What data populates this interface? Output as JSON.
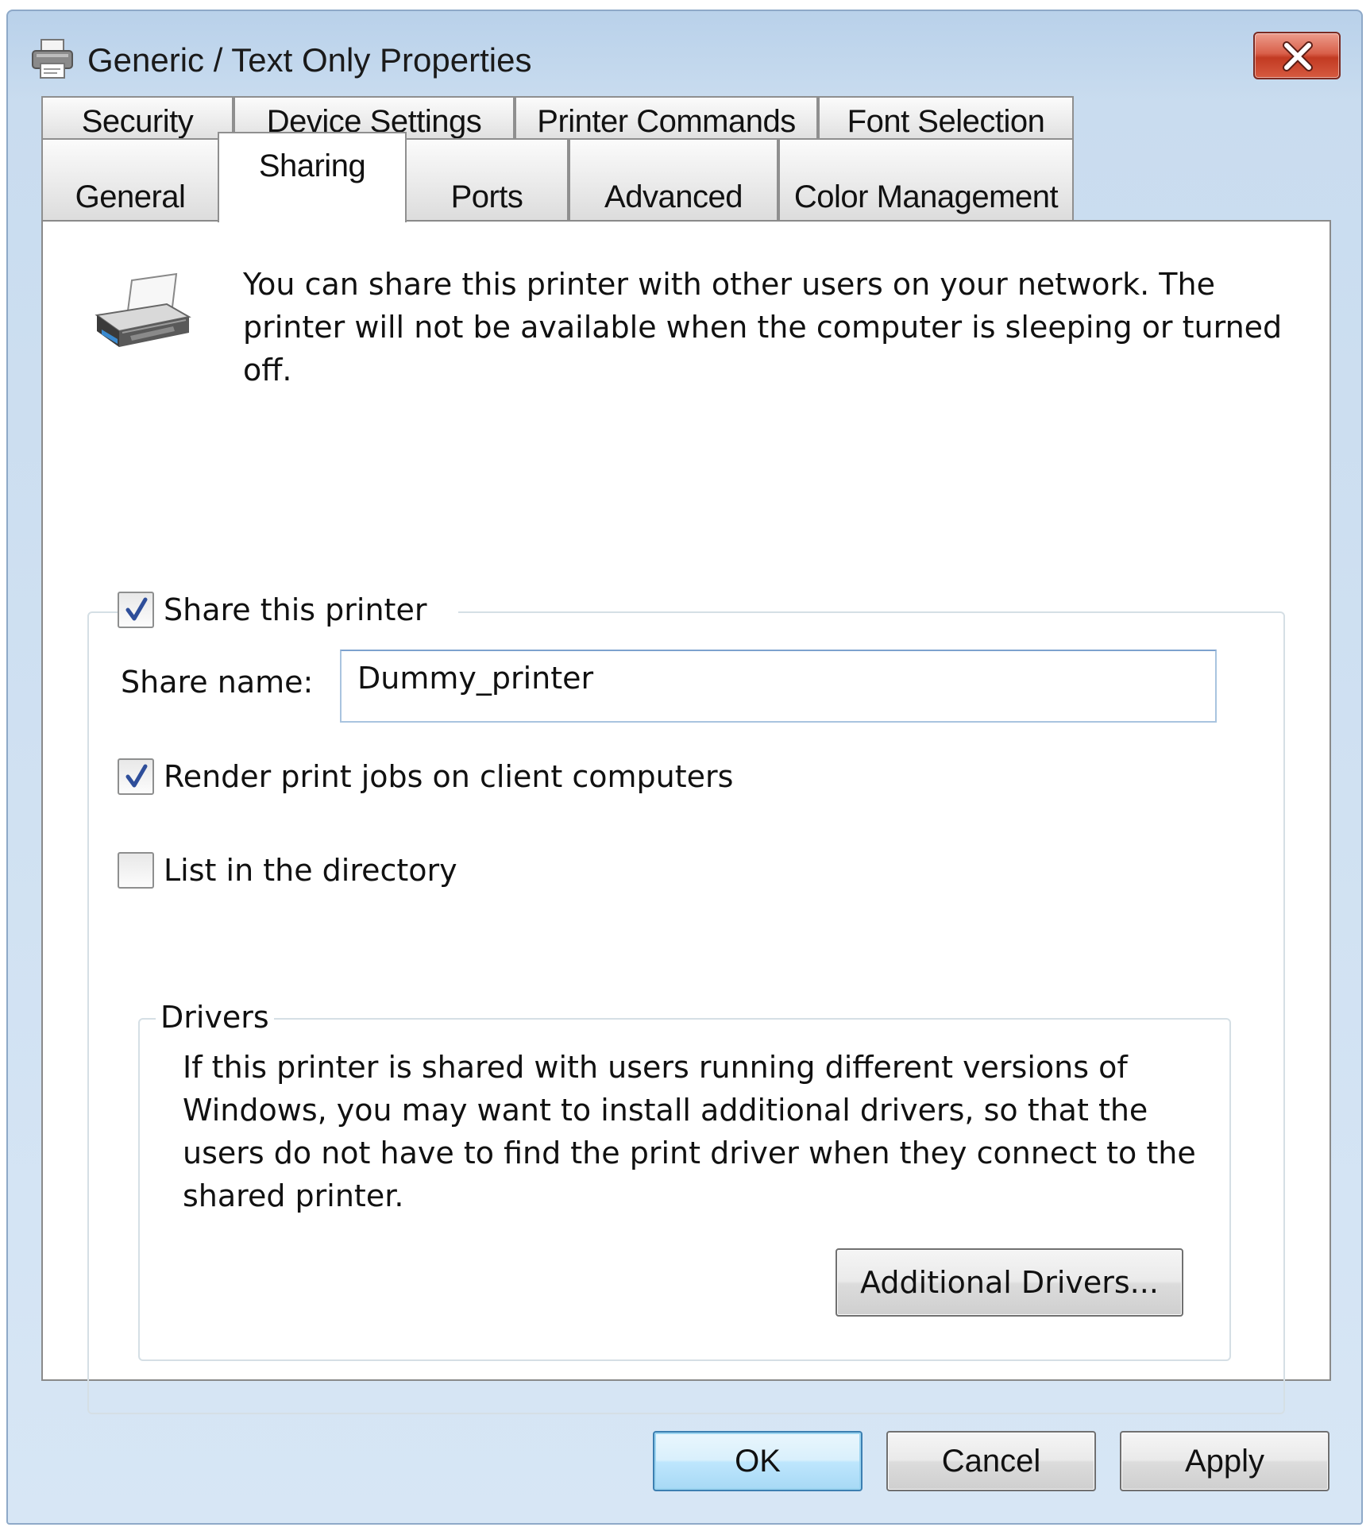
{
  "window": {
    "title": "Generic / Text Only Properties",
    "title_icon": "printer-icon",
    "close_icon": "close-icon"
  },
  "tabs": {
    "row_back": [
      {
        "label": "Security"
      },
      {
        "label": "Device Settings"
      },
      {
        "label": "Printer Commands"
      },
      {
        "label": "Font Selection"
      }
    ],
    "row_front": [
      {
        "label": "General"
      },
      {
        "label": "Sharing"
      },
      {
        "label": "Ports"
      },
      {
        "label": "Advanced"
      },
      {
        "label": "Color Management"
      }
    ],
    "active": "Sharing"
  },
  "sharing": {
    "intro_icon": "printer-icon",
    "intro_text": "You can share this printer with other users on your network. The printer will not be available when the computer is sleeping or turned off.",
    "share_checkbox": {
      "label": "Share this printer",
      "checked": true
    },
    "share_name_label": "Share name:",
    "share_name_value": "Dummy_printer",
    "render_checkbox": {
      "label": "Render print jobs on client computers",
      "checked": true
    },
    "list_checkbox": {
      "label": "List in the directory",
      "checked": false
    }
  },
  "drivers": {
    "legend": "Drivers",
    "text": "If this printer is shared with users running different versions of Windows, you may want to install additional drivers, so that the users do not have to find the print driver when they connect to the shared printer.",
    "button_label": "Additional Drivers..."
  },
  "footer": {
    "ok_label": "OK",
    "cancel_label": "Cancel",
    "apply_label": "Apply"
  },
  "colors": {
    "title_bar": "#c9dcef",
    "close_button": "#c23a22",
    "default_button": "#bee6fd"
  }
}
